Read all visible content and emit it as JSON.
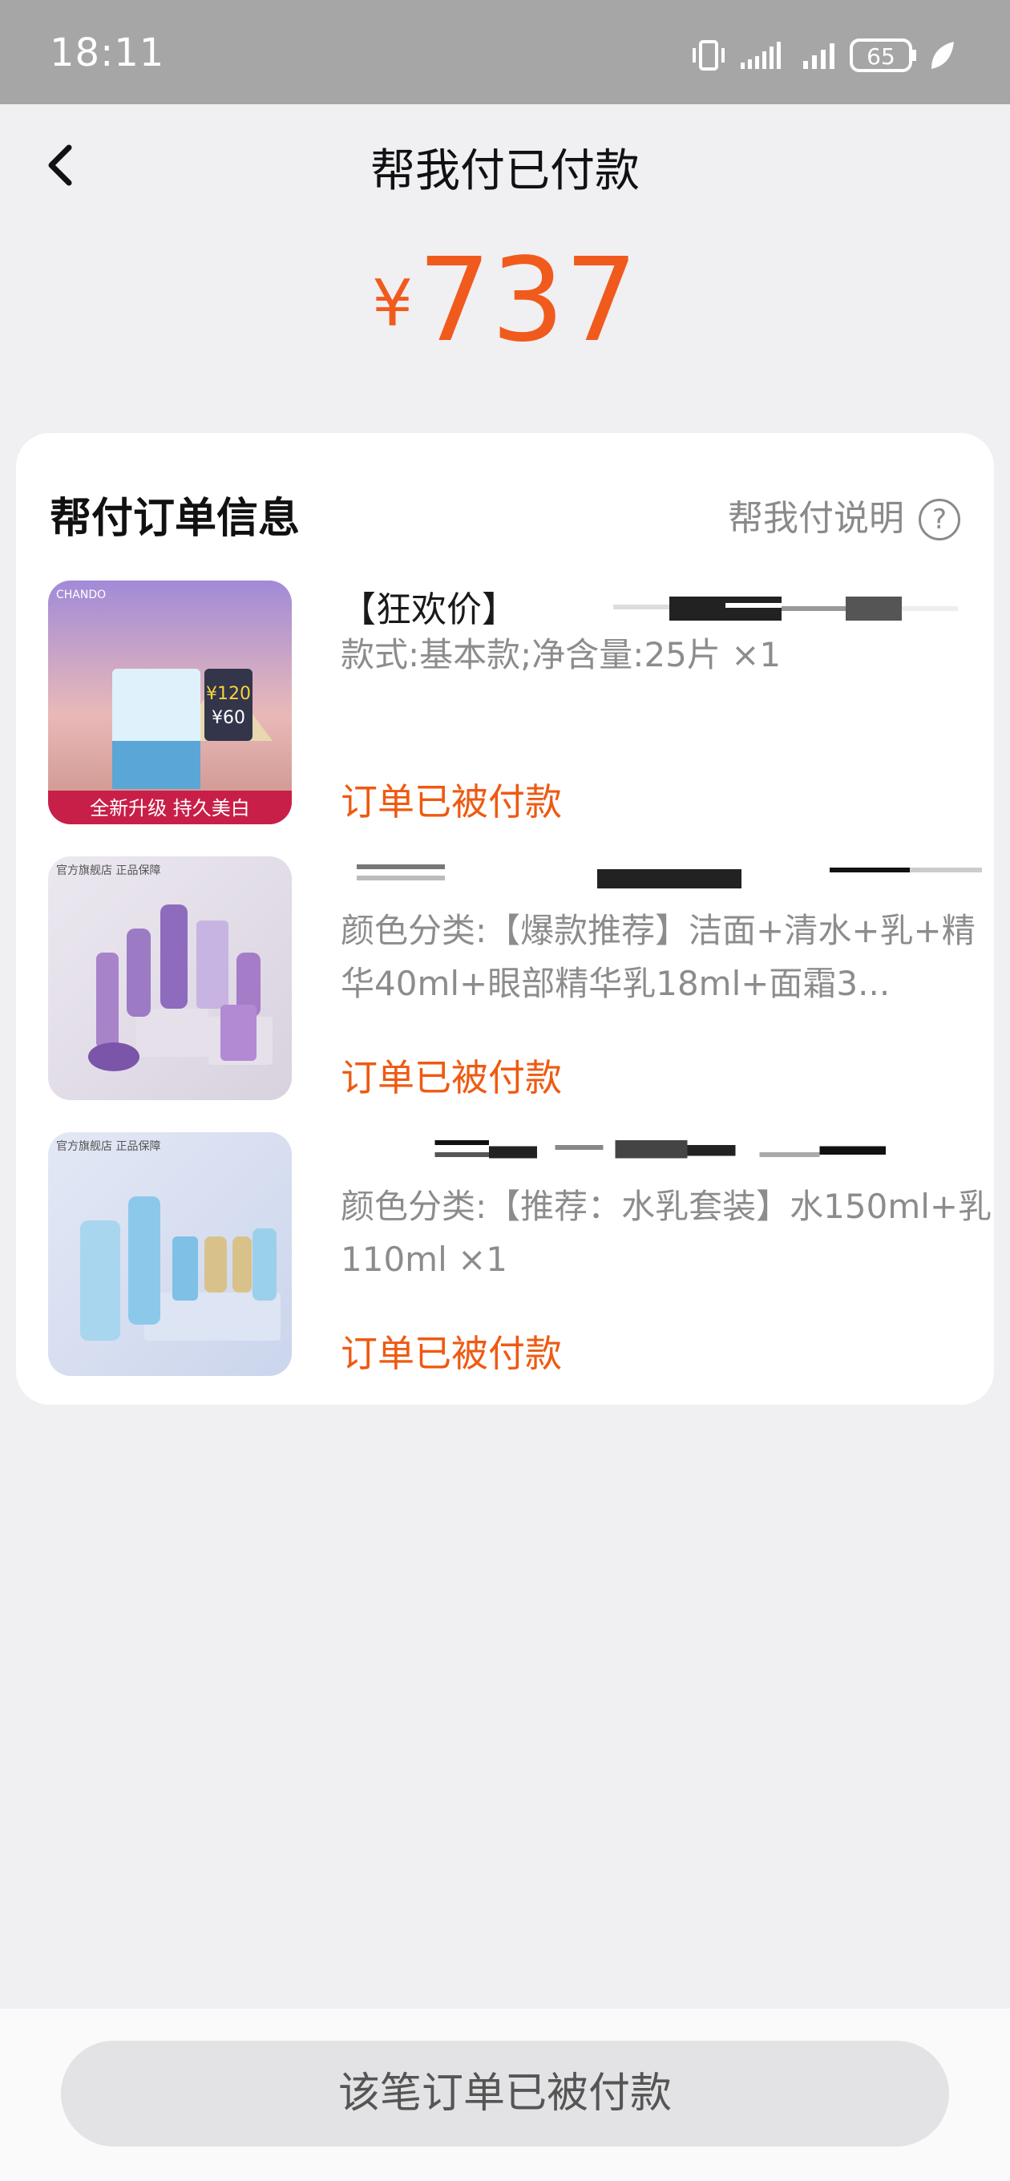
{
  "status_bar": {
    "time": "18:11",
    "battery": "65"
  },
  "nav": {
    "title": "帮我付已付款"
  },
  "amount": {
    "currency": "¥",
    "value": "737"
  },
  "card": {
    "title": "帮付订单信息",
    "help_label": "帮我付说明",
    "items": [
      {
        "title": "【狂欢价】",
        "spec": "款式:基本款;净含量:25片 ×1",
        "status": "订单已被付款",
        "thumb_banner": "全新升级 持久美白",
        "thumb_brand": "CHANDO"
      },
      {
        "title": "",
        "spec": "颜色分类:【爆款推荐】洁面+清水+乳+精华40ml+眼部精华乳18ml+面霜3...",
        "status": "订单已被付款",
        "thumb_badge": "官方旗舰店 正品保障"
      },
      {
        "title": "",
        "spec": "颜色分类:【推荐：水乳套装】水150ml+乳110ml ×1",
        "status": "订单已被付款",
        "thumb_badge": "官方旗舰店 正品保障"
      }
    ]
  },
  "bottom": {
    "button_label": "该笔订单已被付款"
  },
  "colors": {
    "accent": "#f15a1d",
    "status": "#ee5a12"
  }
}
